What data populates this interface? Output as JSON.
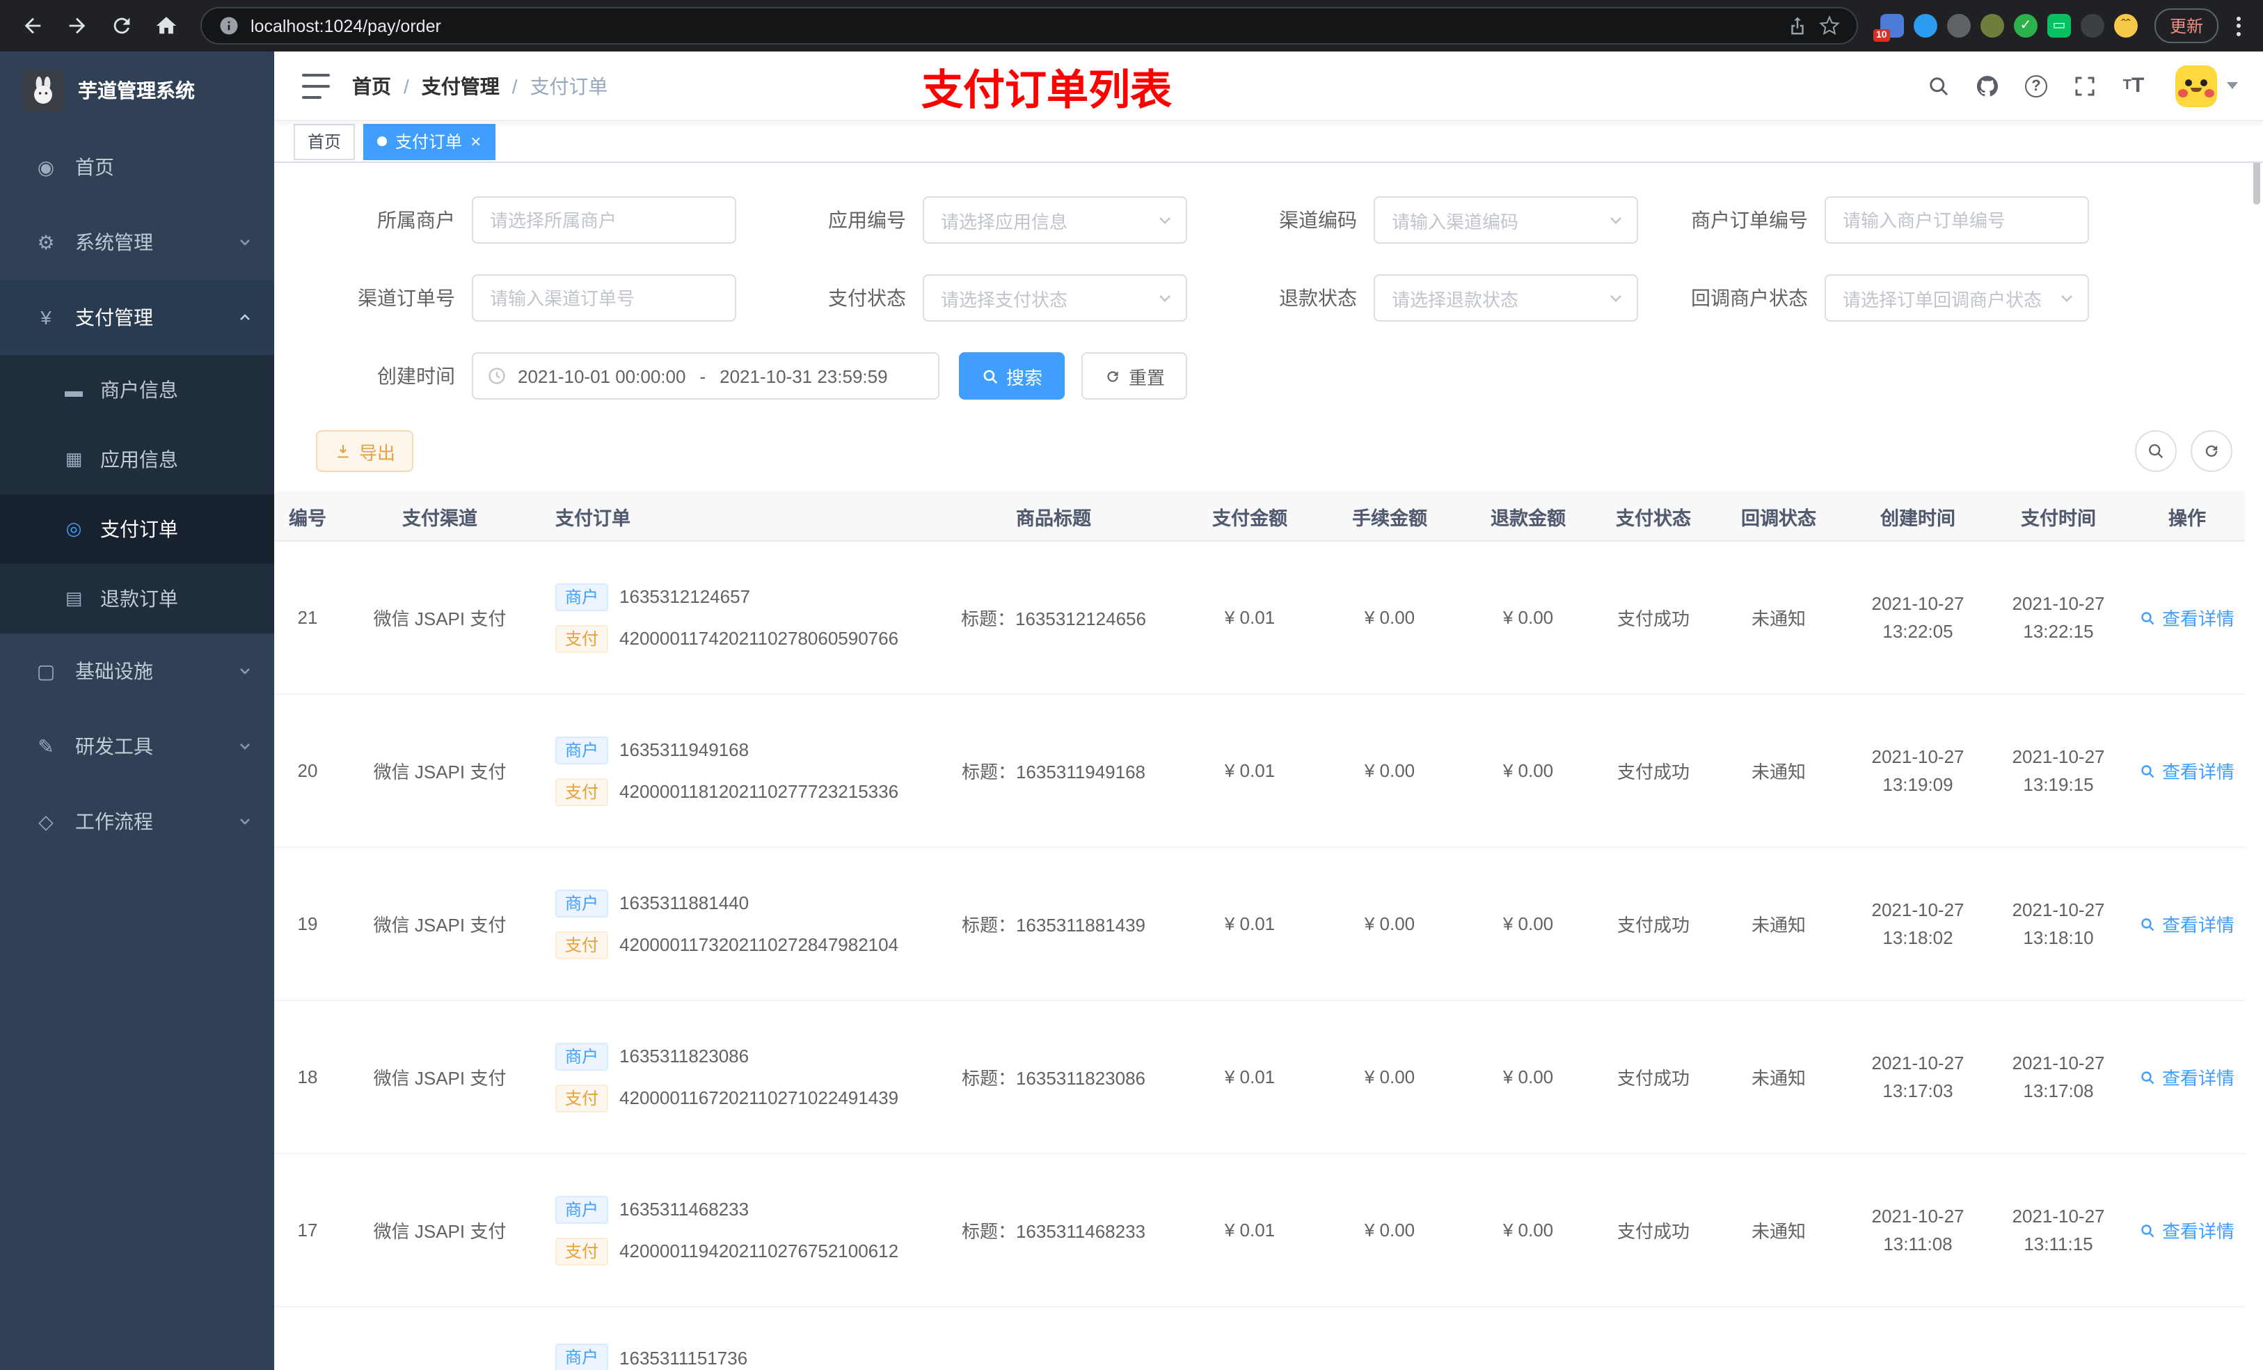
{
  "colors": {
    "accent": "#409EFF",
    "annotation": "#FF0000",
    "warning": "#E6A23C"
  },
  "browser": {
    "url": "localhost:1024/pay/order",
    "update_label": "更新",
    "extension_badge": "10"
  },
  "sidebar": {
    "logo_title": "芋道管理系统",
    "menu": [
      {
        "label": "首页"
      },
      {
        "label": "系统管理"
      },
      {
        "label": "支付管理"
      },
      {
        "label": "基础设施"
      },
      {
        "label": "研发工具"
      },
      {
        "label": "工作流程"
      }
    ],
    "submenu": [
      {
        "label": "商户信息"
      },
      {
        "label": "应用信息"
      },
      {
        "label": "支付订单"
      },
      {
        "label": "退款订单"
      }
    ]
  },
  "header": {
    "breadcrumb": [
      "首页",
      "支付管理",
      "支付订单"
    ],
    "annotation": "支付订单列表"
  },
  "tabs": [
    {
      "label": "首页"
    },
    {
      "label": "支付订单"
    }
  ],
  "filters": {
    "fields_row1": [
      {
        "label": "所属商户",
        "placeholder": "请选择所属商户"
      },
      {
        "label": "应用编号",
        "placeholder": "请选择应用信息"
      },
      {
        "label": "渠道编码",
        "placeholder": "请输入渠道编码"
      },
      {
        "label": "商户订单编号",
        "placeholder": "请输入商户订单编号"
      }
    ],
    "fields_row2": [
      {
        "label": "渠道订单号",
        "placeholder": "请输入渠道订单号"
      },
      {
        "label": "支付状态",
        "placeholder": "请选择支付状态"
      },
      {
        "label": "退款状态",
        "placeholder": "请选择退款状态"
      },
      {
        "label": "回调商户状态",
        "placeholder": "请选择订单回调商户状态"
      }
    ],
    "time": {
      "label": "创建时间",
      "start": "2021-10-01 00:00:00",
      "separator": "-",
      "end": "2021-10-31 23:59:59"
    },
    "search_label": "搜索",
    "reset_label": "重置"
  },
  "toolbar": {
    "export_label": "导出"
  },
  "table": {
    "columns": [
      "编号",
      "支付渠道",
      "支付订单",
      "商品标题",
      "支付金额",
      "手续金额",
      "退款金额",
      "支付状态",
      "回调状态",
      "创建时间",
      "支付时间",
      "操作"
    ],
    "merchant_tag": "商户",
    "pay_tag": "支付",
    "action_label": "查看详情",
    "rows": [
      {
        "id": "21",
        "channel": "微信 JSAPI 支付",
        "merchant_no": "1635312124657",
        "pay_no": "4200001174202110278060590766",
        "title": "标题：1635312124656",
        "amount": "¥ 0.01",
        "fee": "¥ 0.00",
        "refund": "¥ 0.00",
        "status": "支付成功",
        "notify": "未通知",
        "create_date": "2021-10-27",
        "create_time": "13:22:05",
        "pay_date": "2021-10-27",
        "pay_time": "13:22:15"
      },
      {
        "id": "20",
        "channel": "微信 JSAPI 支付",
        "merchant_no": "1635311949168",
        "pay_no": "4200001181202110277723215336",
        "title": "标题：1635311949168",
        "amount": "¥ 0.01",
        "fee": "¥ 0.00",
        "refund": "¥ 0.00",
        "status": "支付成功",
        "notify": "未通知",
        "create_date": "2021-10-27",
        "create_time": "13:19:09",
        "pay_date": "2021-10-27",
        "pay_time": "13:19:15"
      },
      {
        "id": "19",
        "channel": "微信 JSAPI 支付",
        "merchant_no": "1635311881440",
        "pay_no": "4200001173202110272847982104",
        "title": "标题：1635311881439",
        "amount": "¥ 0.01",
        "fee": "¥ 0.00",
        "refund": "¥ 0.00",
        "status": "支付成功",
        "notify": "未通知",
        "create_date": "2021-10-27",
        "create_time": "13:18:02",
        "pay_date": "2021-10-27",
        "pay_time": "13:18:10"
      },
      {
        "id": "18",
        "channel": "微信 JSAPI 支付",
        "merchant_no": "1635311823086",
        "pay_no": "4200001167202110271022491439",
        "title": "标题：1635311823086",
        "amount": "¥ 0.01",
        "fee": "¥ 0.00",
        "refund": "¥ 0.00",
        "status": "支付成功",
        "notify": "未通知",
        "create_date": "2021-10-27",
        "create_time": "13:17:03",
        "pay_date": "2021-10-27",
        "pay_time": "13:17:08"
      },
      {
        "id": "17",
        "channel": "微信 JSAPI 支付",
        "merchant_no": "1635311468233",
        "pay_no": "4200001194202110276752100612",
        "title": "标题：1635311468233",
        "amount": "¥ 0.01",
        "fee": "¥ 0.00",
        "refund": "¥ 0.00",
        "status": "支付成功",
        "notify": "未通知",
        "create_date": "2021-10-27",
        "create_time": "13:11:08",
        "pay_date": "2021-10-27",
        "pay_time": "13:11:15"
      }
    ],
    "partial_row": {
      "merchant_no": "1635311151736"
    }
  }
}
